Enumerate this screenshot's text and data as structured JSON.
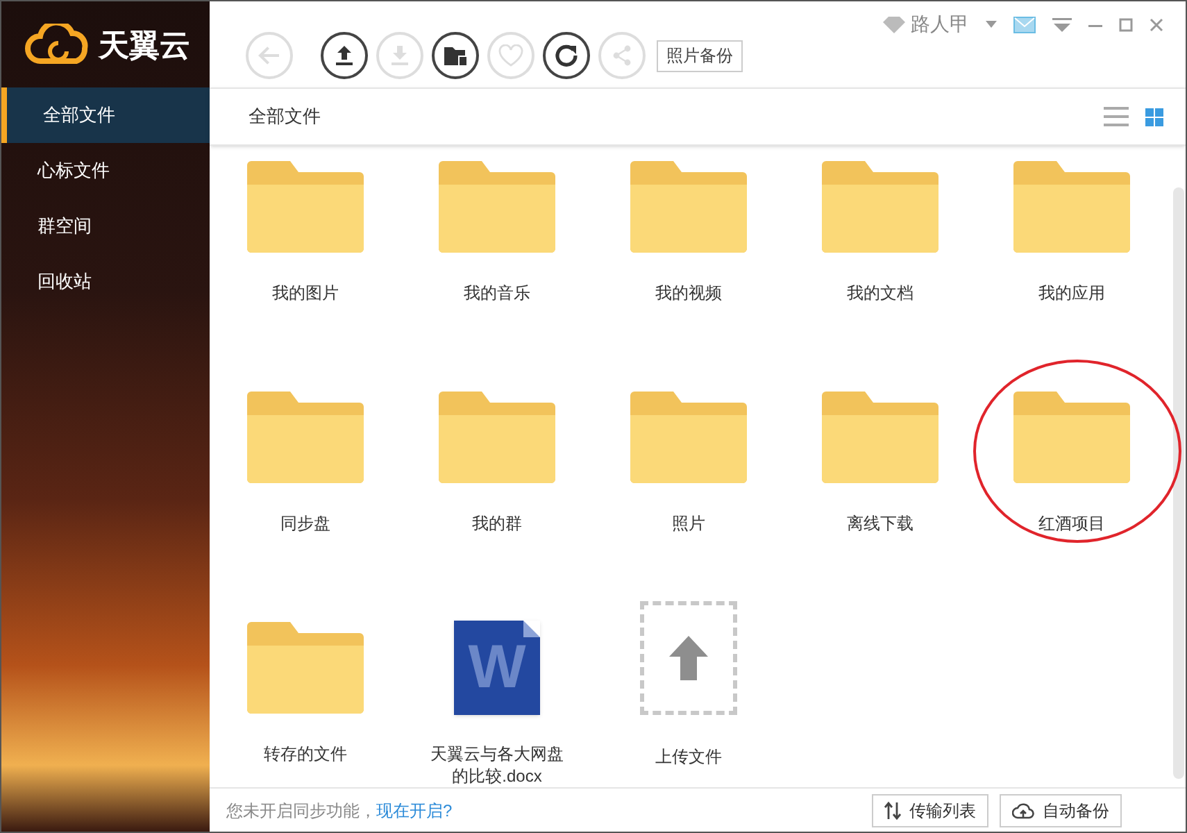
{
  "app": {
    "name": "天翼云"
  },
  "sidebar": {
    "items": [
      {
        "label": "全部文件",
        "selected": true
      },
      {
        "label": "心标文件",
        "selected": false
      },
      {
        "label": "群空间",
        "selected": false
      },
      {
        "label": "回收站",
        "selected": false
      }
    ]
  },
  "toolbar": {
    "buttons": [
      {
        "kind": "back",
        "disabled": true
      },
      {
        "kind": "upload",
        "disabled": false
      },
      {
        "kind": "download",
        "disabled": true
      },
      {
        "kind": "new-folder",
        "disabled": false
      },
      {
        "kind": "favorite",
        "disabled": true
      },
      {
        "kind": "refresh",
        "disabled": false
      },
      {
        "kind": "share",
        "disabled": true
      }
    ],
    "photo_backup": "照片备份"
  },
  "user": {
    "name": "路人甲"
  },
  "breadcrumb": "全部文件",
  "view": {
    "list_selected": false,
    "grid_selected": true
  },
  "files": [
    {
      "kind": "folder",
      "name": "我的图片",
      "highlighted": false
    },
    {
      "kind": "folder",
      "name": "我的音乐",
      "highlighted": false
    },
    {
      "kind": "folder",
      "name": "我的视频",
      "highlighted": false
    },
    {
      "kind": "folder",
      "name": "我的文档",
      "highlighted": false
    },
    {
      "kind": "folder",
      "name": "我的应用",
      "highlighted": false
    },
    {
      "kind": "folder",
      "name": "同步盘",
      "highlighted": false
    },
    {
      "kind": "folder",
      "name": "我的群",
      "highlighted": false
    },
    {
      "kind": "folder",
      "name": "照片",
      "highlighted": false
    },
    {
      "kind": "folder",
      "name": "离线下载",
      "highlighted": false
    },
    {
      "kind": "folder",
      "name": "红酒项目",
      "highlighted": true
    },
    {
      "kind": "folder",
      "name": "转存的文件",
      "highlighted": false
    },
    {
      "kind": "word",
      "name": "天翼云与各大网盘的比较.docx",
      "icon_letter": "W",
      "highlighted": false
    },
    {
      "kind": "upload",
      "name": "上传文件",
      "highlighted": false
    }
  ],
  "status_bar": {
    "message": "您未开启同步功能，",
    "link": "现在开启?",
    "buttons": [
      {
        "kind": "transfer",
        "label": "传输列表"
      },
      {
        "kind": "backup",
        "label": "自动备份"
      }
    ]
  }
}
